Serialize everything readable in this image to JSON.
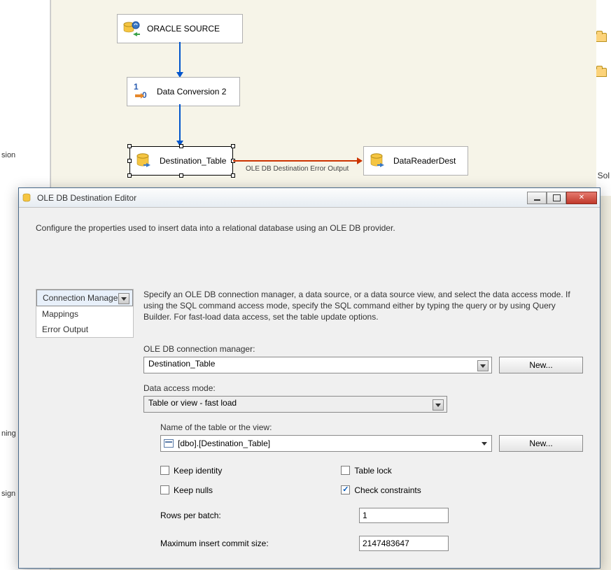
{
  "leftStrip": {
    "label1": "sion",
    "label2": "ning",
    "label3": "sign"
  },
  "rightStrip": {
    "sol": "Sol"
  },
  "canvas": {
    "nodes": {
      "source": "ORACLE SOURCE",
      "conversion": "Data Conversion 2",
      "dest": "Destination_Table",
      "reader": "DataReaderDest"
    },
    "edgeLabel": "OLE DB Destination Error Output"
  },
  "dialog": {
    "title": "OLE DB Destination Editor",
    "topDesc": "Configure the properties used to insert data into a relational database using an OLE DB provider.",
    "tabs": [
      "Connection Manager",
      "Mappings",
      "Error Output"
    ],
    "para": "Specify an OLE DB connection manager, a data source, or a data source view, and select the data access mode. If using the SQL command access mode, specify the SQL command either by typing the query or by using Query Builder. For fast-load data access, set the table update options.",
    "labels": {
      "connMgr": "OLE DB connection manager:",
      "accessMode": "Data access mode:",
      "tableName": "Name of the table or the view:",
      "new": "New...",
      "keepIdentity": "Keep identity",
      "keepNulls": "Keep nulls",
      "tableLock": "Table lock",
      "checkConstraints": "Check constraints",
      "rowsPerBatch": "Rows per batch:",
      "maxCommit": "Maximum insert commit size:"
    },
    "values": {
      "connMgr": "Destination_Table",
      "accessMode": "Table or view - fast load",
      "tableName": "[dbo].[Destination_Table]",
      "rowsPerBatch": "1",
      "maxCommit": "2147483647"
    }
  }
}
